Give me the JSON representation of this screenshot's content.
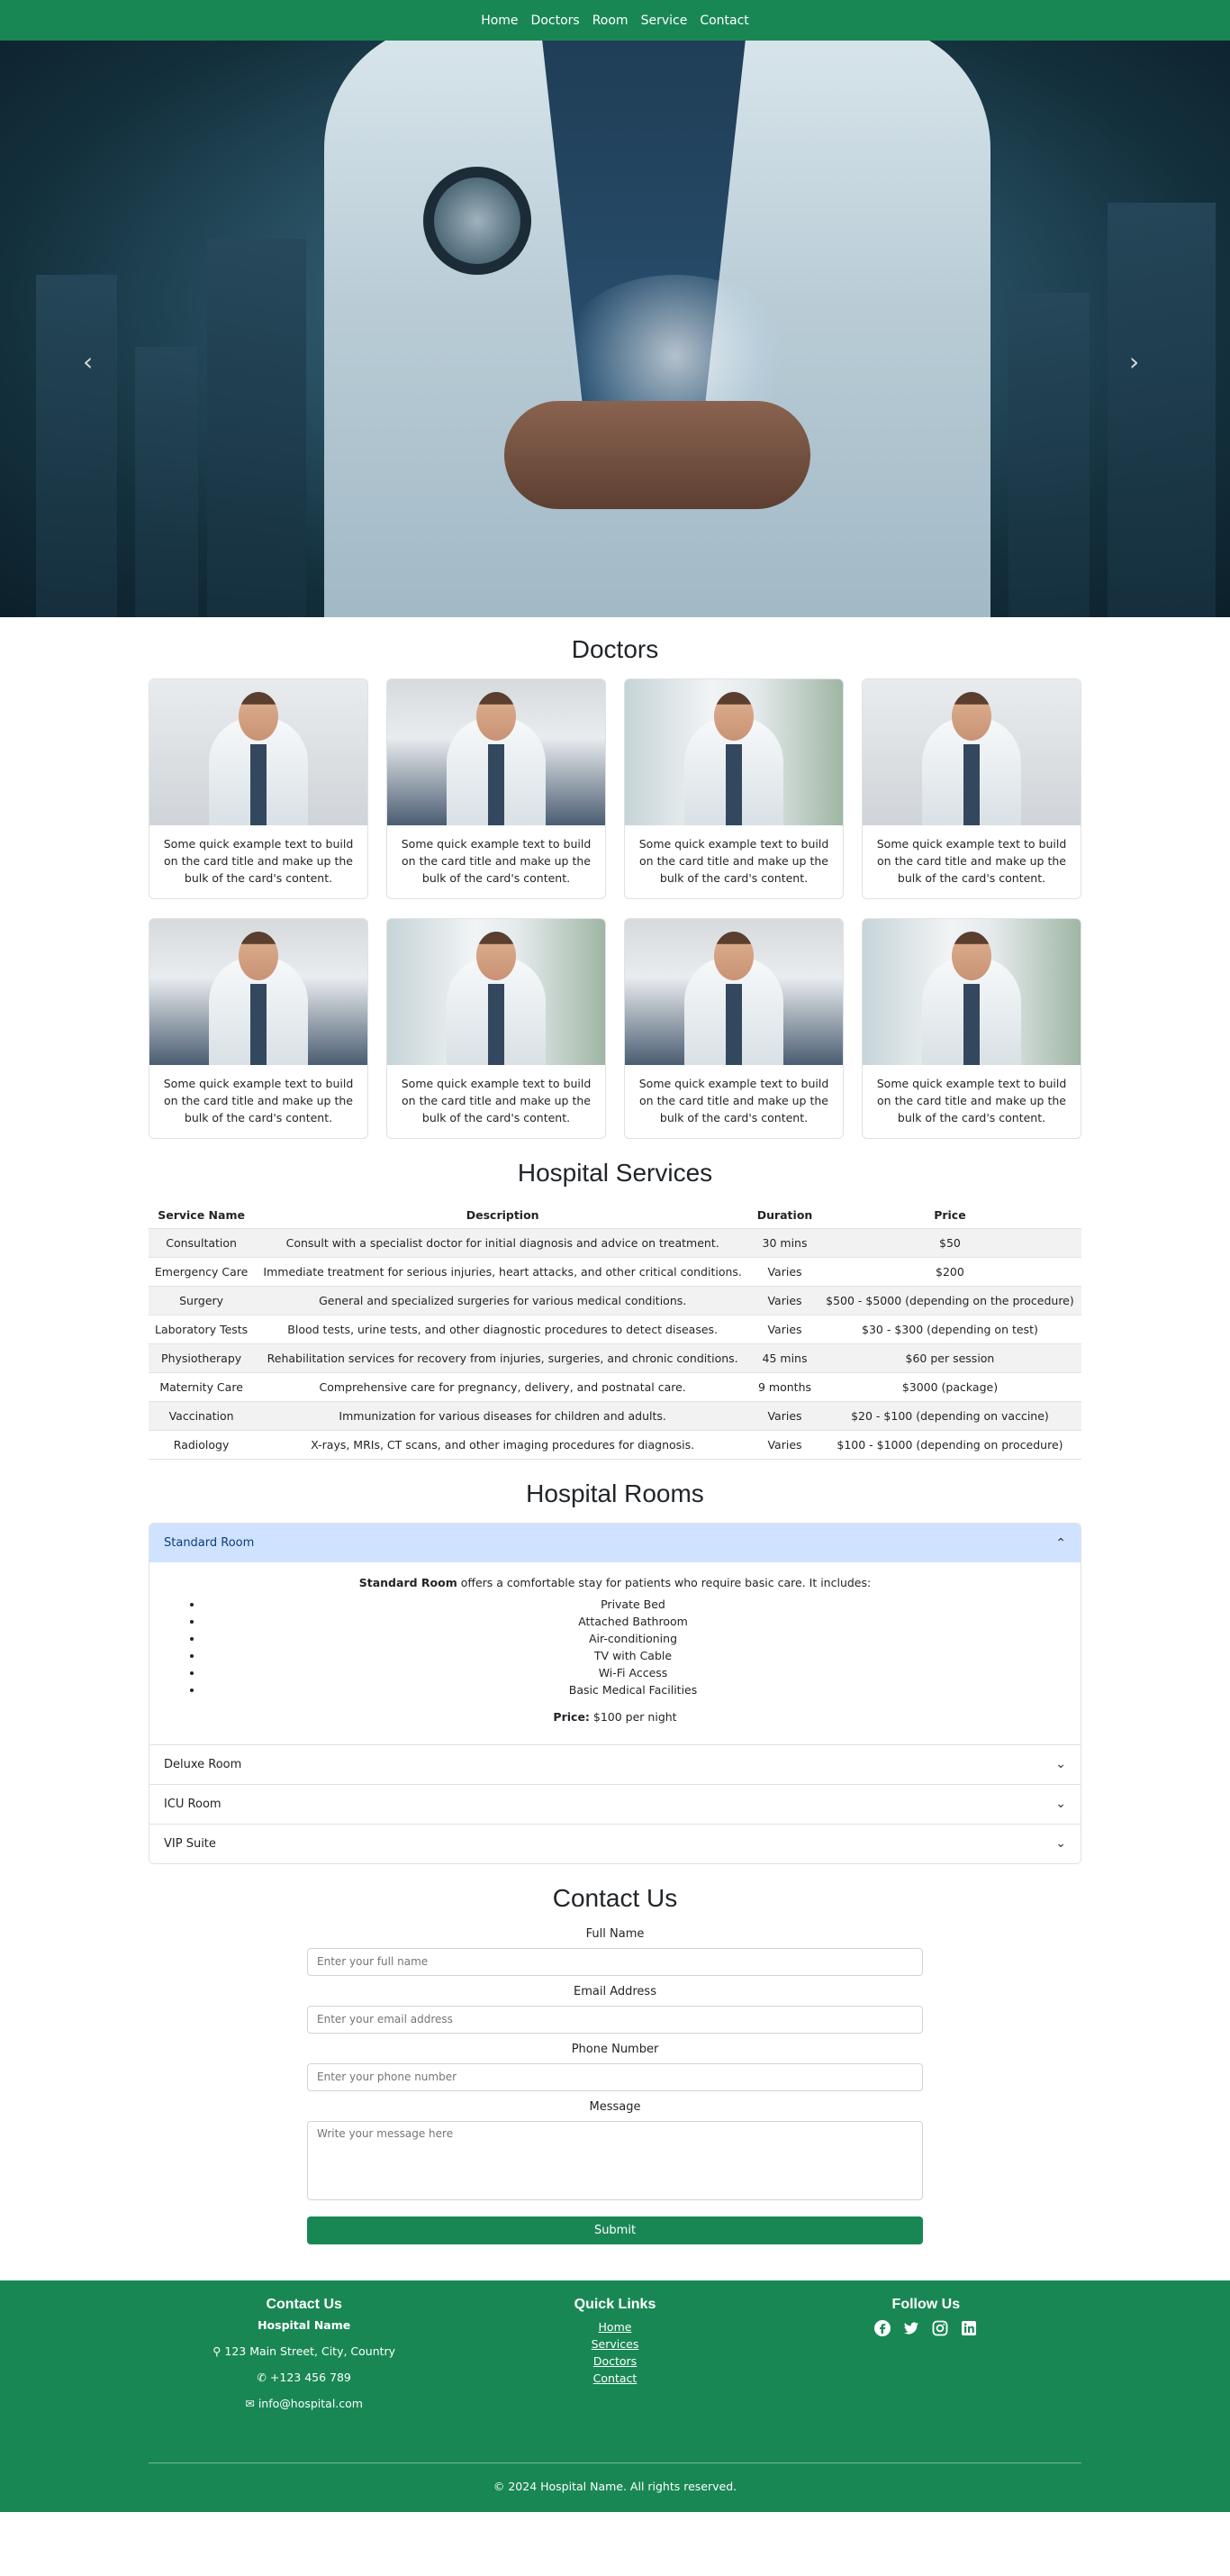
{
  "nav": {
    "items": [
      "Home",
      "Doctors",
      "Room",
      "Service",
      "Contact"
    ]
  },
  "hero": {
    "prev_icon": "chevron-left-icon",
    "next_icon": "chevron-right-icon"
  },
  "doctors": {
    "title": "Doctors",
    "card_text": "Some quick example text to build on the card title and make up the bulk of the card's content.",
    "cards": [
      {
        "photo": "male-doctor-grey-background"
      },
      {
        "photo": "female-doctor-office"
      },
      {
        "photo": "male-doctor-bright-corridor"
      },
      {
        "photo": "male-doctor-grey-background"
      },
      {
        "photo": "female-doctor-office"
      },
      {
        "photo": "male-doctor-bright-corridor"
      },
      {
        "photo": "female-doctor-office"
      },
      {
        "photo": "male-doctor-bright-corridor"
      }
    ]
  },
  "services": {
    "title": "Hospital Services",
    "headers": [
      "Service Name",
      "Description",
      "Duration",
      "Price"
    ],
    "rows": [
      [
        "Consultation",
        "Consult with a specialist doctor for initial diagnosis and advice on treatment.",
        "30 mins",
        "$50"
      ],
      [
        "Emergency Care",
        "Immediate treatment for serious injuries, heart attacks, and other critical conditions.",
        "Varies",
        "$200"
      ],
      [
        "Surgery",
        "General and specialized surgeries for various medical conditions.",
        "Varies",
        "$500 - $5000 (depending on the procedure)"
      ],
      [
        "Laboratory Tests",
        "Blood tests, urine tests, and other diagnostic procedures to detect diseases.",
        "Varies",
        "$30 - $300 (depending on test)"
      ],
      [
        "Physiotherapy",
        "Rehabilitation services for recovery from injuries, surgeries, and chronic conditions.",
        "45 mins",
        "$60 per session"
      ],
      [
        "Maternity Care",
        "Comprehensive care for pregnancy, delivery, and postnatal care.",
        "9 months",
        "$3000 (package)"
      ],
      [
        "Vaccination",
        "Immunization for various diseases for children and adults.",
        "Varies",
        "$20 - $100 (depending on vaccine)"
      ],
      [
        "Radiology",
        "X-rays, MRIs, CT scans, and other imaging procedures for diagnosis.",
        "Varies",
        "$100 - $1000 (depending on procedure)"
      ]
    ]
  },
  "rooms": {
    "title": "Hospital Rooms",
    "items": [
      {
        "label": "Standard Room",
        "open": true,
        "intro_bold": "Standard Room",
        "intro_rest": " offers a comfortable stay for patients who require basic care. It includes:",
        "features": [
          "Private Bed",
          "Attached Bathroom",
          "Air-conditioning",
          "TV with Cable",
          "Wi-Fi Access",
          "Basic Medical Facilities"
        ],
        "price_label": "Price:",
        "price_value": " $100 per night"
      },
      {
        "label": "Deluxe Room",
        "open": false
      },
      {
        "label": "ICU Room",
        "open": false
      },
      {
        "label": "VIP Suite",
        "open": false
      }
    ]
  },
  "contact": {
    "title": "Contact Us",
    "fields": {
      "name": {
        "label": "Full Name",
        "placeholder": "Enter your full name"
      },
      "email": {
        "label": "Email Address",
        "placeholder": "Enter your email address"
      },
      "phone": {
        "label": "Phone Number",
        "placeholder": "Enter your phone number"
      },
      "message": {
        "label": "Message",
        "placeholder": "Write your message here"
      }
    },
    "submit": "Submit"
  },
  "footer": {
    "contact_title": "Contact Us",
    "hospital_name": "Hospital Name",
    "address": "123 Main Street, City, Country",
    "phone": "+123 456 789",
    "email": "info@hospital.com",
    "links_title": "Quick Links",
    "links": [
      "Home",
      "Services",
      "Doctors",
      "Contact"
    ],
    "follow_title": "Follow Us",
    "social": [
      "facebook-icon",
      "twitter-icon",
      "instagram-icon",
      "linkedin-icon"
    ],
    "copyright": "© 2024 Hospital Name. All rights reserved."
  }
}
